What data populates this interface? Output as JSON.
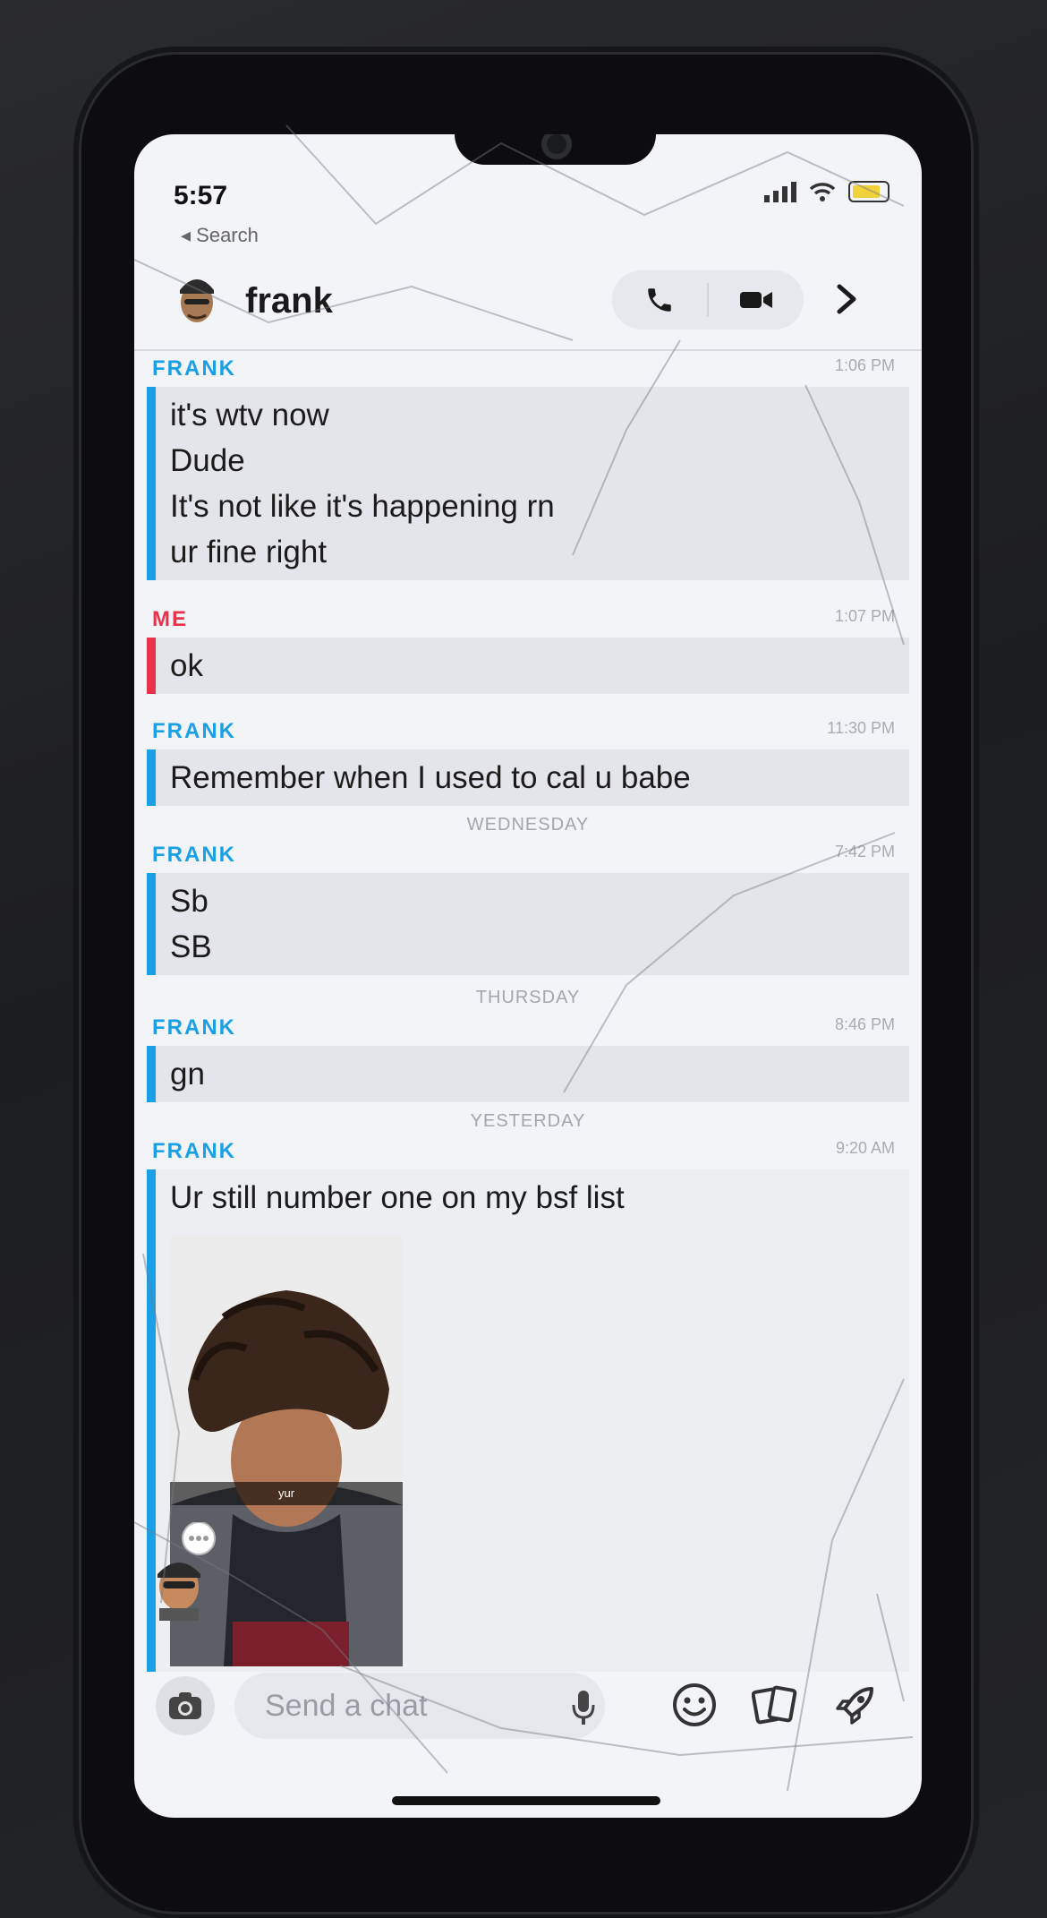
{
  "status_bar": {
    "time": "5:57",
    "back_label": "Search"
  },
  "header": {
    "contact_name": "frank"
  },
  "chat": [
    {
      "sender": "FRANK",
      "time": "1:06 PM",
      "messages": [
        "it's wtv now",
        "Dude",
        "It's not like it's happening rn",
        "ur fine right"
      ]
    },
    {
      "sender": "ME",
      "time": "1:07 PM",
      "messages": [
        "ok"
      ]
    },
    {
      "sender": "FRANK",
      "time": "11:30 PM",
      "messages": [
        "Remember when I used to cal u babe"
      ]
    },
    {
      "day": "WEDNESDAY"
    },
    {
      "sender": "FRANK",
      "time": "7:42 PM",
      "messages": [
        "Sb",
        "SB"
      ]
    },
    {
      "day": "THURSDAY"
    },
    {
      "sender": "FRANK",
      "time": "8:46 PM",
      "messages": [
        "gn"
      ]
    },
    {
      "day": "YESTERDAY"
    },
    {
      "sender": "FRANK",
      "time": "9:20 AM",
      "messages": [
        "Ur still number one on my bsf list"
      ],
      "photo_caption": "yur"
    }
  ],
  "composer": {
    "placeholder": "Send a chat"
  },
  "colors": {
    "frank": "#1aa0e6",
    "me": "#e8334a",
    "bubble": "#e4e5ea"
  },
  "icons": [
    "back-icon",
    "signal-icon",
    "wifi-icon",
    "battery-icon",
    "avatar",
    "phone-icon",
    "video-icon",
    "chevron-right-icon",
    "camera-icon",
    "mic-icon",
    "smiley-icon",
    "cards-icon",
    "rocket-icon"
  ]
}
